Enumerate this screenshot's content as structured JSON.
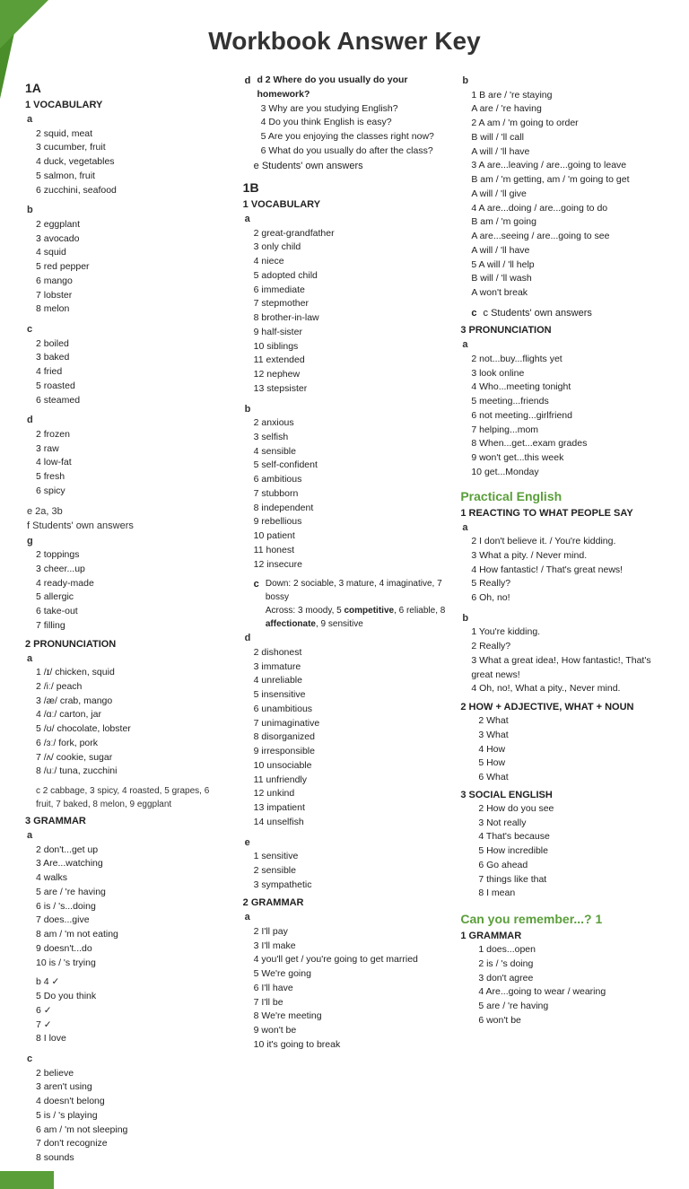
{
  "title": "Workbook Answer Key",
  "col1": {
    "section1A": "1A",
    "vocab_header": "1 VOCABULARY",
    "vocab_a_items": [
      "2 squid, meat",
      "3 cucumber, fruit",
      "4 duck, vegetables",
      "5 salmon, fruit",
      "6 zucchini, seafood"
    ],
    "vocab_b_items": [
      "2 eggplant",
      "3 avocado",
      "4 squid",
      "5 red pepper",
      "6 mango",
      "7 lobster",
      "8 melon"
    ],
    "vocab_c_items": [
      "2 boiled",
      "3 baked",
      "4 fried",
      "5 roasted",
      "6 steamed"
    ],
    "vocab_d_items": [
      "2 frozen",
      "3 raw",
      "4 low-fat",
      "5 fresh",
      "6 spicy"
    ],
    "vocab_e": "e 2a, 3b",
    "vocab_f": "f Students' own answers",
    "vocab_g_items": [
      "2 toppings",
      "3 cheer...up",
      "4 ready-made",
      "5 allergic",
      "6 take-out",
      "7 filling"
    ],
    "pronun_header": "2 PRONUNCIATION",
    "pronun_a_items": [
      "1 /ɪ/ chicken, squid",
      "2 /iː/ peach",
      "3 /æ/ crab, mango",
      "4 /ɑː/ carton, jar",
      "5 /ʊ/ chocolate, lobster",
      "6 /ɜː/ fork, pork",
      "7 /ʌ/ cookie, sugar",
      "8 /uː/ tuna, zucchini"
    ],
    "pronun_b": "c 2 cabbage, 3 spicy, 4 roasted, 5 grapes, 6 fruit, 7 baked, 8 melon, 9 eggplant",
    "grammar_header": "3 GRAMMAR",
    "grammar_a_items": [
      "2 don't...get up",
      "3 Are...watching",
      "4 walks",
      "5 are / 're having",
      "6 is / 's...doing",
      "7 does...give",
      "8 am / 'm not eating",
      "9 doesn't...do",
      "10 is / 's trying"
    ],
    "grammar_b_items": [
      "b 4 ✓",
      "5 Do you think",
      "6 ✓",
      "7 ✓",
      "8 I love"
    ],
    "grammar_c_items": [
      "2 believe",
      "3 aren't using",
      "4 doesn't belong",
      "5 is / 's playing",
      "6 am / 'm not sleeping",
      "7 don't recognize",
      "8 sounds"
    ]
  },
  "col2": {
    "section1B": "1B",
    "vocab_header": "1 VOCABULARY",
    "vocab_a_items": [
      "2 great-grandfather",
      "3 only child",
      "4 niece",
      "5 adopted child",
      "6 immediate",
      "7 stepmother",
      "8 brother-in-law",
      "9 half-sister",
      "10 siblings",
      "11 extended",
      "12 nephew",
      "13 stepsister"
    ],
    "vocab_b_items": [
      "2 anxious",
      "3 selfish",
      "4 sensible",
      "5 self-confident",
      "6 ambitious",
      "7 stubborn",
      "8 independent",
      "9 rebellious",
      "10 patient",
      "11 honest",
      "12 insecure"
    ],
    "vocab_c": "c Down: 2 sociable, 3 mature, 4 imaginative, 7 bossy\nAcross: 3 moody, 5 competitive, 6 reliable, 8 affectionate, 9 sensitive",
    "vocab_d_items": [
      "2 dishonest",
      "3 immature",
      "4 unreliable",
      "5 insensitive",
      "6 unambitious",
      "7 unimaginative",
      "8 disorganized",
      "9 irresponsible",
      "10 unsociable",
      "11 unfriendly",
      "12 unkind",
      "13 impatient",
      "14 unselfish"
    ],
    "vocab_e_items": [
      "1 sensitive",
      "2 sensible",
      "3 sympathetic"
    ],
    "grammar_header": "2 GRAMMAR",
    "grammar_a_items": [
      "2 I'll pay",
      "3 I'll make",
      "4 you'll get / you're going to get married",
      "5 We're going",
      "6 I'll have",
      "7 I'll be",
      "8 We're meeting",
      "9 won't be",
      "10 it's going to break"
    ],
    "d_header": "d 2 Where do you usually do your homework?",
    "d_items": [
      "3 Why are you studying English?",
      "4 Do you think English is easy?",
      "5 Are you enjoying the classes right now?",
      "6 What do you usually do after the class?"
    ],
    "e": "e Students' own answers"
  },
  "col3": {
    "grammar_b_items": [
      "1 B are / 're staying",
      "A are / 're having",
      "2 A am / 'm going to order",
      "B will / 'll call",
      "A will / 'll have",
      "3 A are...leaving / are...going to leave",
      "B am / 'm getting, am / 'm going to get",
      "A will / 'll give",
      "4 A are...doing / are...going to do",
      "B am / 'm going",
      "A are...seeing / are...going to see",
      "A will / 'll have",
      "5 A will / 'll help",
      "B will / 'll wash",
      "A won't break"
    ],
    "grammar_c": "c Students' own answers",
    "pronun_header": "3 PRONUNCIATION",
    "pronun_a_items": [
      "2 not...buy...flights yet",
      "3 look online",
      "4 Who...meeting tonight",
      "5 meeting...friends",
      "6 not meeting...girlfriend",
      "7 helping...mom",
      "8 When...get...exam grades",
      "9 won't get...this week",
      "10 get...Monday"
    ],
    "practical_english_header": "Practical English",
    "reacting_header": "1 REACTING TO WHAT PEOPLE SAY",
    "reacting_a_items": [
      "2 I don't believe it. / You're kidding.",
      "3 What a pity. / Never mind.",
      "4 How fantastic! / That's great news!",
      "5 Really?",
      "6 Oh, no!"
    ],
    "reacting_b_items": [
      "1 You're kidding.",
      "2 Really?",
      "3 What a great idea!, How fantastic!, That's great news!",
      "4 Oh, no!, What a pity., Never mind."
    ],
    "how_header": "2 HOW + ADJECTIVE, WHAT + NOUN",
    "how_items": [
      "2 What",
      "3 What",
      "4 How",
      "5 How",
      "6 What"
    ],
    "social_header": "3 SOCIAL ENGLISH",
    "social_items": [
      "2 How do you see",
      "3 Not really",
      "4 That's because",
      "5 How incredible",
      "6 Go ahead",
      "7 things like that",
      "8 I mean"
    ],
    "can_remember_header": "Can you remember...? 1",
    "can_grammar_header": "1 GRAMMAR",
    "can_grammar_items": [
      "1 does...open",
      "2 is / 's doing",
      "3 don't agree",
      "4 Are...going to wear / wearing",
      "5 are / 're having",
      "6 won't be"
    ]
  }
}
